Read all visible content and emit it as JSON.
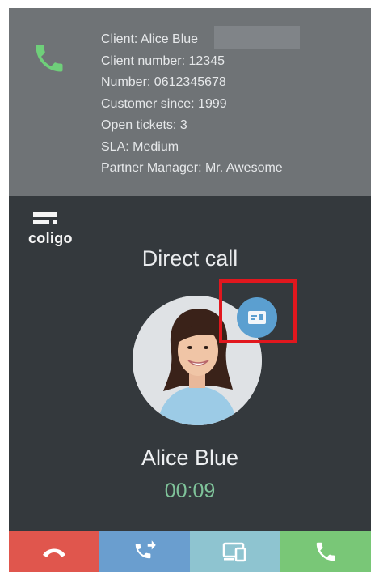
{
  "client_info": {
    "lines": [
      "Client: Alice Blue",
      "Client number: 12345",
      "Number: 0612345678",
      "Customer since: 1999",
      "Open tickets: 3",
      "SLA: Medium",
      "Partner Manager: Mr. Awesome"
    ],
    "icon": "phone-icon"
  },
  "brand": {
    "logo_text": "coligo"
  },
  "call": {
    "type": "Direct call",
    "caller_name": "Alice Blue",
    "duration": "00:09",
    "contact_card_icon": "contact-card-icon"
  },
  "actions": [
    {
      "name": "hang-up",
      "icon": "hang-up-icon",
      "color": "#e0564d"
    },
    {
      "name": "transfer",
      "icon": "call-transfer-icon",
      "color": "#6a9ecf"
    },
    {
      "name": "device-switch",
      "icon": "device-switch-icon",
      "color": "#8ec4d0"
    },
    {
      "name": "answer",
      "icon": "phone-icon",
      "color": "#79c777"
    }
  ],
  "colors": {
    "info_panel": "#6f7376",
    "background": "#34393d",
    "timer": "#7fc39a",
    "badge": "#5b9fd0",
    "highlight": "#e1171e"
  }
}
